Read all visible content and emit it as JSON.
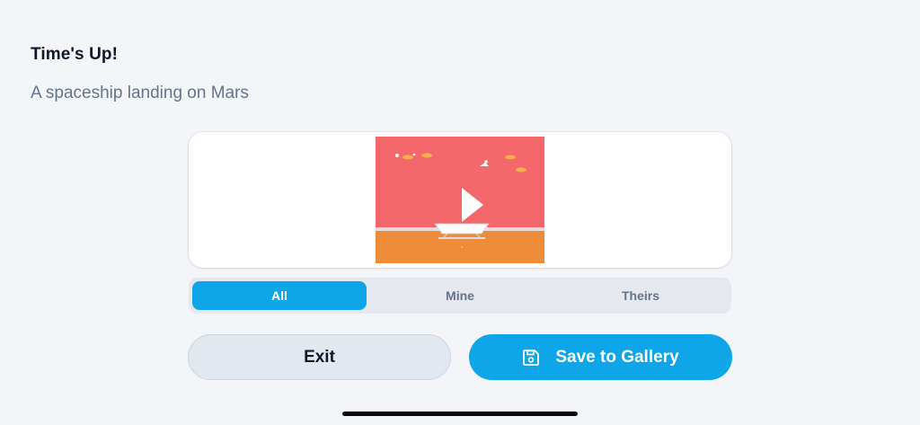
{
  "header": {
    "title": "Time's Up!",
    "prompt": "A spaceship landing on Mars"
  },
  "preview": {
    "icon": "play-icon",
    "colors": {
      "sky": "#f4676a",
      "ground": "#ef8c3a"
    }
  },
  "filter_tabs": [
    {
      "label": "All",
      "active": true
    },
    {
      "label": "Mine",
      "active": false
    },
    {
      "label": "Theirs",
      "active": false
    }
  ],
  "actions": {
    "exit_label": "Exit",
    "save_label": "Save to Gallery",
    "save_icon": "save-icon"
  },
  "colors": {
    "accent": "#0ea5e9",
    "background": "#f4f5f9"
  }
}
